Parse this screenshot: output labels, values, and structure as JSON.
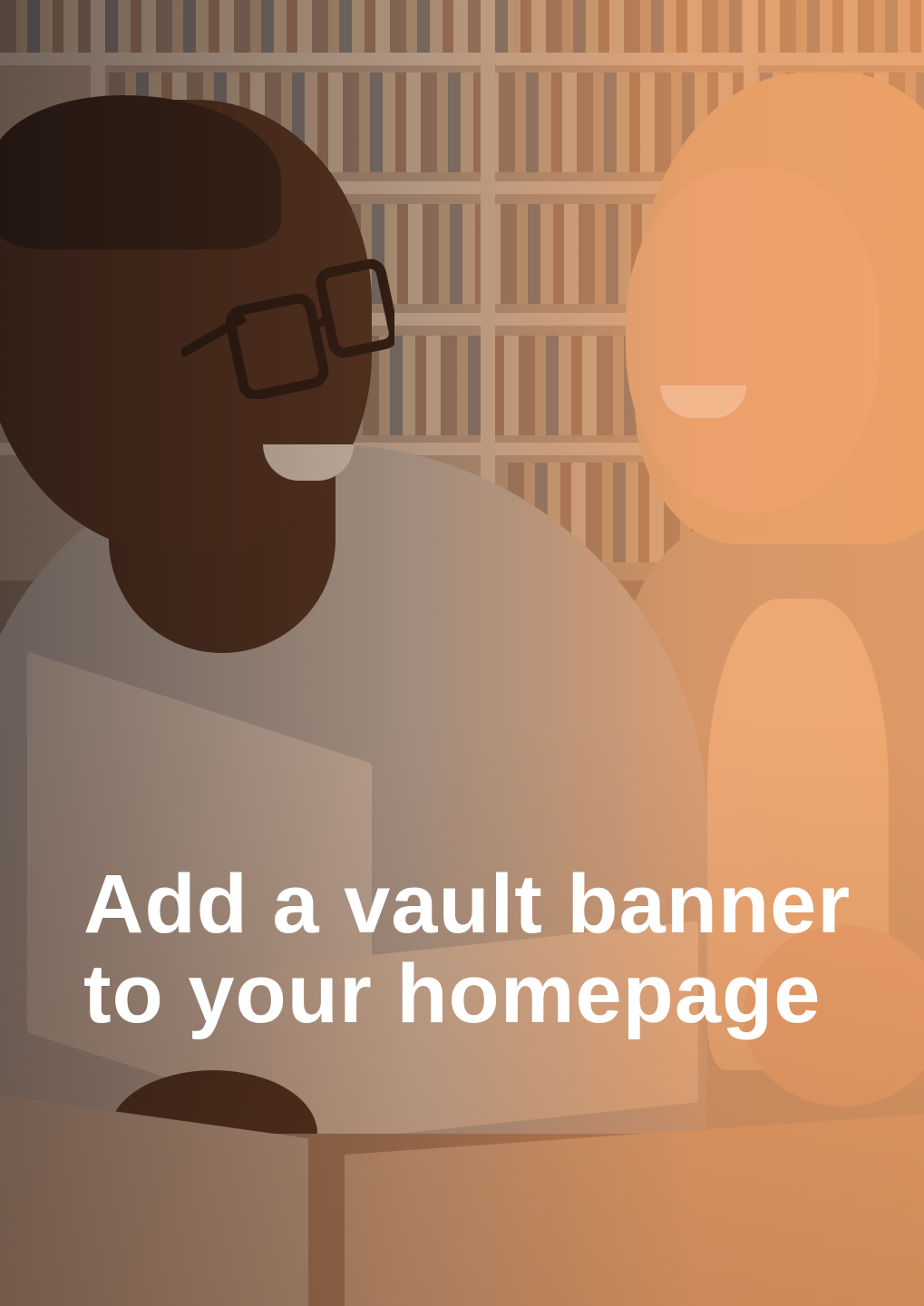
{
  "banner": {
    "headline_line1": "Add a vault banner",
    "headline_line2": "to your homepage",
    "background_image": "students-reading-in-library-photo",
    "overlay_color": "#f08c46",
    "text_color": "#ffffff"
  }
}
